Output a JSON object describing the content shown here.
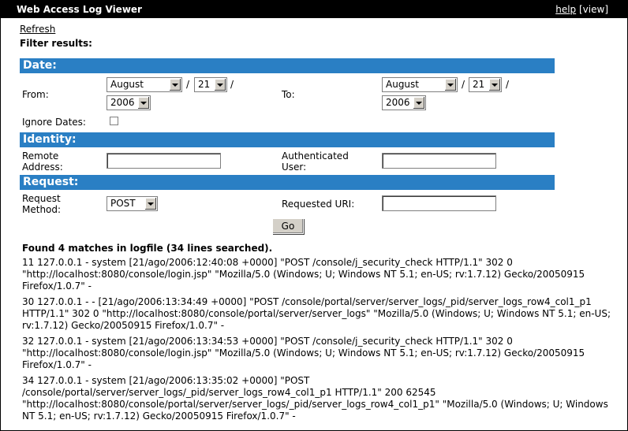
{
  "app": {
    "title": "Web Access Log Viewer",
    "help_label": "help",
    "view_label": "[view]"
  },
  "refresh_label": "Refresh",
  "filter_heading": "Filter results:",
  "date": {
    "section_title": "Date:",
    "from_label": "From:",
    "to_label": "To:",
    "from_month": "August",
    "from_day": "21",
    "from_year": "2006",
    "to_month": "August",
    "to_day": "21",
    "to_year": "2006",
    "slash": "/",
    "ignore_label": "Ignore Dates:"
  },
  "identity": {
    "section_title": "Identity:",
    "remote_label_1": "Remote",
    "remote_label_2": "Address:",
    "auth_label_1": "Authenticated",
    "auth_label_2": "User:",
    "remote_value": "",
    "auth_value": ""
  },
  "request": {
    "section_title": "Request:",
    "method_label_1": "Request",
    "method_label_2": "Method:",
    "method_value": "POST",
    "uri_label": "Requested URI:",
    "uri_value": ""
  },
  "go_label": "Go",
  "results": {
    "summary": "Found 4 matches in logfile (34 lines searched).",
    "entries": [
      "11 127.0.0.1 - system [21/ago/2006:12:40:08 +0000] \"POST /console/j_security_check HTTP/1.1\" 302 0 \"http://localhost:8080/console/login.jsp\" \"Mozilla/5.0 (Windows; U; Windows NT 5.1; en-US; rv:1.7.12) Gecko/20050915 Firefox/1.0.7\" -",
      "30 127.0.0.1 - - [21/ago/2006:13:34:49 +0000] \"POST /console/portal/server/server_logs/_pid/server_logs_row4_col1_p1 HTTP/1.1\" 302 0 \"http://localhost:8080/console/portal/server/server_logs\" \"Mozilla/5.0 (Windows; U; Windows NT 5.1; en-US; rv:1.7.12) Gecko/20050915 Firefox/1.0.7\" -",
      "32 127.0.0.1 - system [21/ago/2006:13:34:53 +0000] \"POST /console/j_security_check HTTP/1.1\" 302 0 \"http://localhost:8080/console/login.jsp\" \"Mozilla/5.0 (Windows; U; Windows NT 5.1; en-US; rv:1.7.12) Gecko/20050915 Firefox/1.0.7\" -",
      "34 127.0.0.1 - system [21/ago/2006:13:35:02 +0000] \"POST /console/portal/server/server_logs/_pid/server_logs_row4_col1_p1 HTTP/1.1\" 200 62545 \"http://localhost:8080/console/portal/server/server_logs/_pid/server_logs_row4_col1_p1\" \"Mozilla/5.0 (Windows; U; Windows NT 5.1; en-US; rv:1.7.12) Gecko/20050915 Firefox/1.0.7\" -"
    ]
  }
}
